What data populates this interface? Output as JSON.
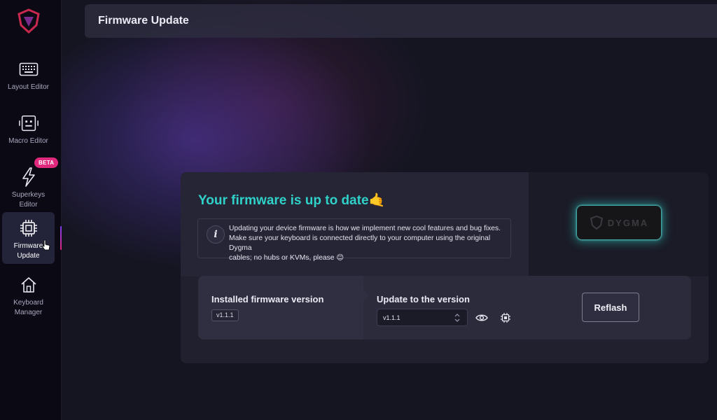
{
  "header": {
    "title": "Firmware Update"
  },
  "sidebar": {
    "items": [
      {
        "label": "Layout Editor",
        "icon": "keyboard-icon"
      },
      {
        "label": "Macro Editor",
        "icon": "macro-icon"
      },
      {
        "label": "Superkeys Editor",
        "icon": "lightning-icon",
        "badge": "BETA"
      },
      {
        "label": "Firmware Update",
        "icon": "chip-icon",
        "active": true
      },
      {
        "label": "Keyboard Manager",
        "icon": "home-icon"
      }
    ]
  },
  "status": {
    "title": "Your firmware is up to date",
    "emoji": "🤙",
    "color": "#2fd1c8"
  },
  "info": {
    "line1": "Updating your device firmware is how we implement new cool features and bug fixes.",
    "line2": "Make sure your keyboard is connected directly to your computer using the original Dygma",
    "line3": "cables; no hubs or KVMs, please",
    "emoji": "😊"
  },
  "device": {
    "name": "DYGMA"
  },
  "installed": {
    "title": "Installed firmware version",
    "version": "v1.1.1"
  },
  "update": {
    "title": "Update to the version",
    "selected_version": "v1.1.1"
  },
  "actions": {
    "reflash_label": "Reflash"
  },
  "colors": {
    "accent": "#2fd1c8",
    "badge": "#e0287d",
    "sidebar": "#0b0a14"
  }
}
